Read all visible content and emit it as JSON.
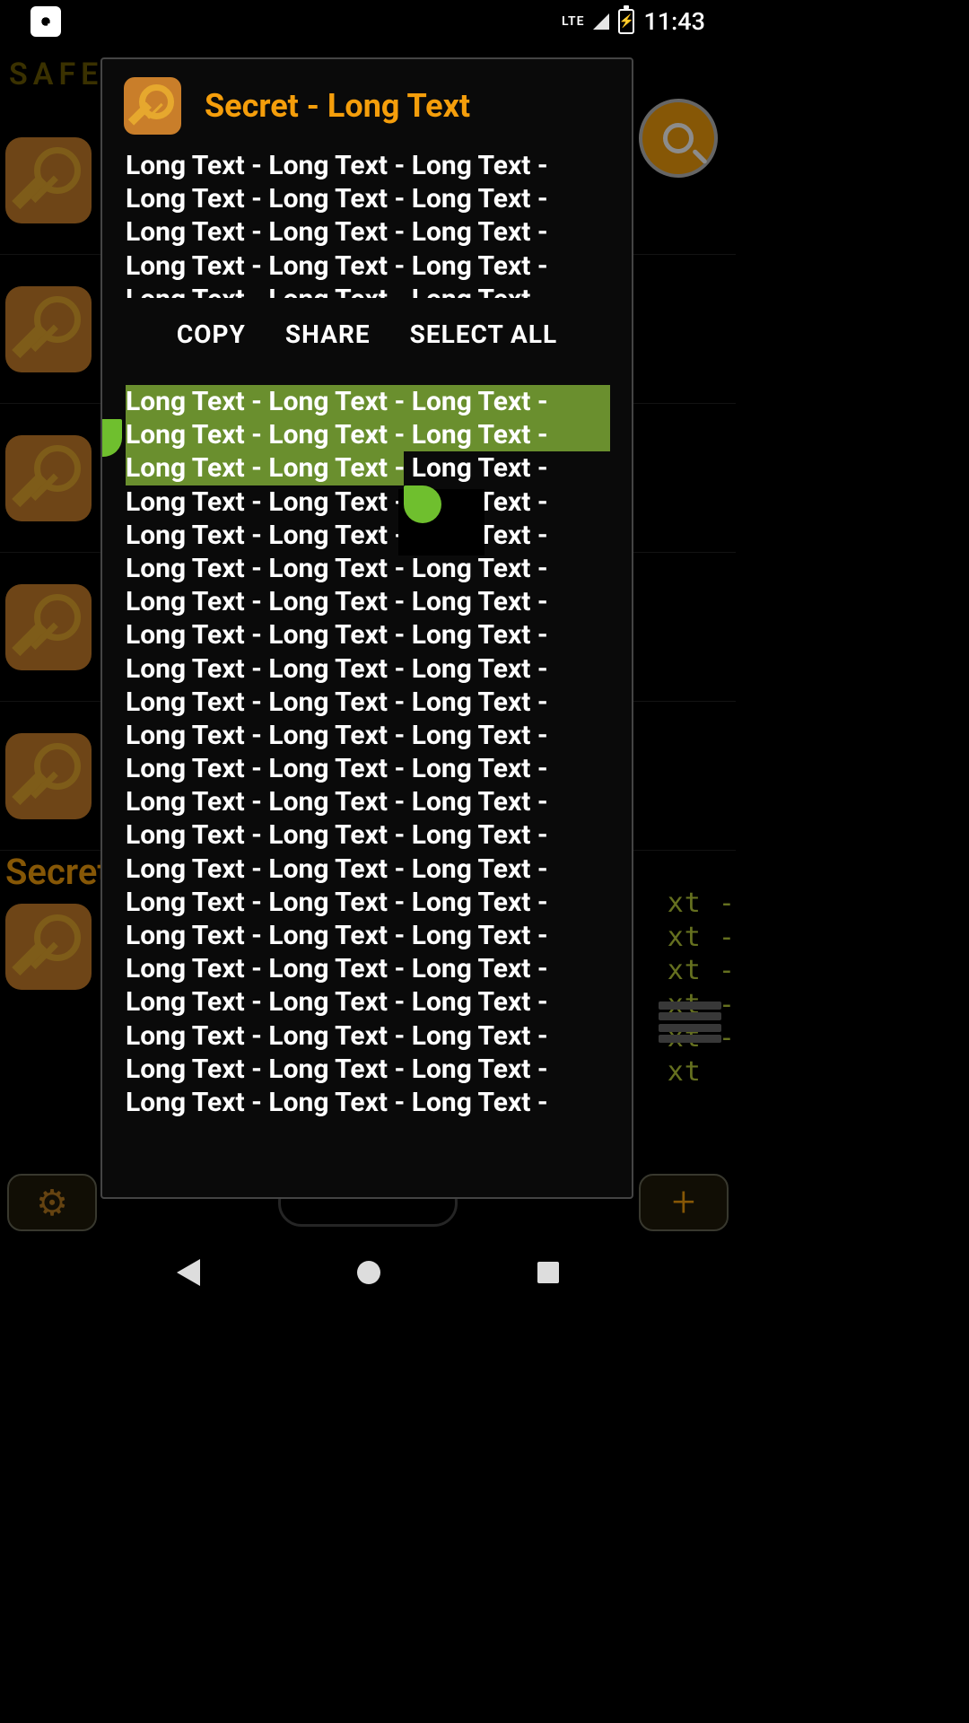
{
  "status": {
    "network": "LTE",
    "clock": "11:43"
  },
  "app_header": {
    "brand": "SAFE",
    "secret_label": "Secret"
  },
  "bg_snippet": "xt -\nxt -\nxt -\nxt -\nxt -\nxt",
  "modal": {
    "title": "Secret - Long Text",
    "line": "Long Text - Long Text - Long Text -",
    "actions": {
      "copy": "COPY",
      "share": "SHARE",
      "select_all": "SELECT ALL"
    }
  }
}
